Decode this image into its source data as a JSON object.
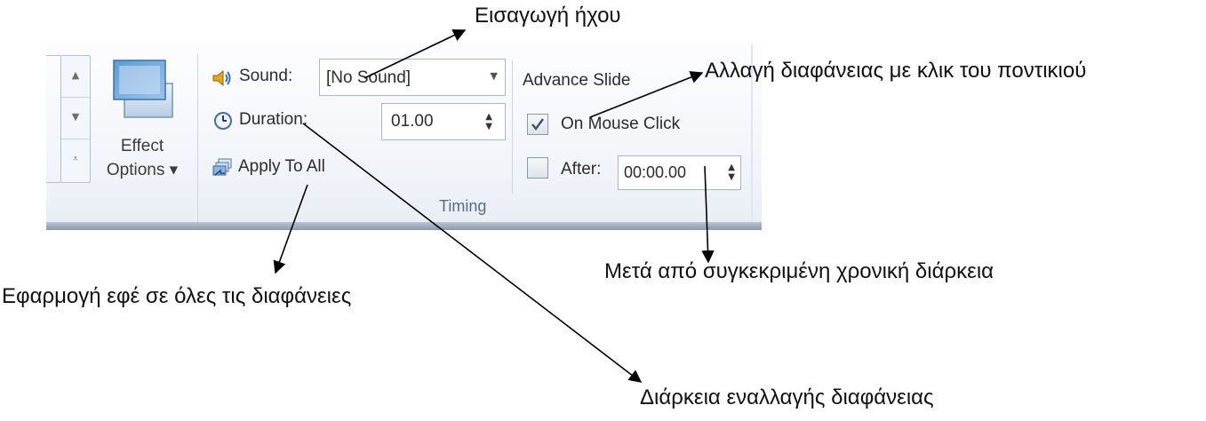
{
  "gallery": {
    "up_glyph": "▲",
    "down_glyph": "▼",
    "more_glyph": "⩡"
  },
  "effect_options": {
    "label_line1": "Effect",
    "label_line2": "Options ▾"
  },
  "sound": {
    "label": "Sound:",
    "value": "[No Sound]",
    "icon": "speaker-icon"
  },
  "duration": {
    "label": "Duration:",
    "value": "01.00",
    "icon": "clock-icon"
  },
  "apply_to_all": {
    "label": "Apply To All",
    "icon": "apply-all-icon"
  },
  "advance_slide": {
    "header": "Advance Slide",
    "on_mouse_click": {
      "label": "On Mouse Click",
      "checked": true
    },
    "after": {
      "label": "After:",
      "checked": false,
      "value": "00:00.00"
    }
  },
  "group_label": "Timing",
  "annotations": {
    "sound": "Εισαγωγή ήχου",
    "mouse_click": "Αλλαγή διαφάνειας με κλικ του ποντικιού",
    "after_time": "Μετά από συγκεκριμένη χρονική διάρκεια",
    "apply_all": "Εφαρμογή εφέ σε όλες τις διαφάνειες",
    "duration": "Διάρκεια εναλλαγής διαφάνειας"
  },
  "colors": {
    "ribbon_bg": "#f1f4f9",
    "ribbon_border": "#8c99aa",
    "group_label": "#5c6b7d",
    "annotation_arrow": "#000000"
  }
}
